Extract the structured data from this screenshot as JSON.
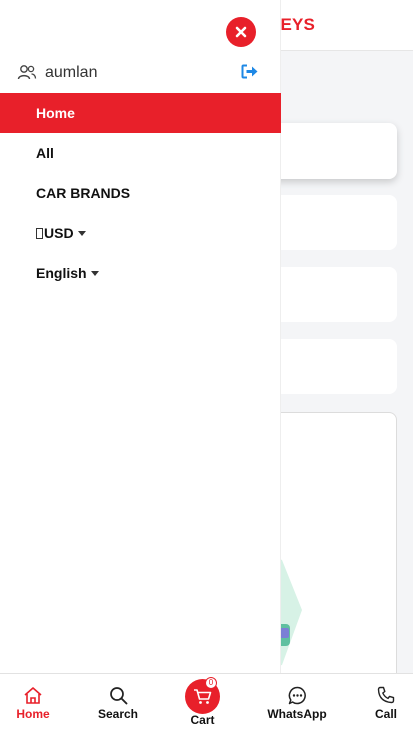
{
  "header": {
    "brand_partial": "KEYS"
  },
  "drawer": {
    "user": {
      "name": "aumlan"
    },
    "menu": [
      {
        "label": "Home",
        "active": true
      },
      {
        "label": "All",
        "active": false
      },
      {
        "label": "CAR BRANDS",
        "active": false
      }
    ],
    "currency": {
      "label": "USD"
    },
    "language": {
      "label": "English"
    }
  },
  "bottom_nav": {
    "home": "Home",
    "search": "Search",
    "cart": "Cart",
    "cart_count": "0",
    "whatsapp": "WhatsApp",
    "call": "Call"
  },
  "colors": {
    "accent": "#e8202a",
    "logout": "#1e88e5"
  },
  "icons": [
    "close-icon",
    "users-icon",
    "logout-icon",
    "home-icon",
    "search-icon",
    "cart-icon",
    "whatsapp-icon",
    "phone-icon"
  ]
}
